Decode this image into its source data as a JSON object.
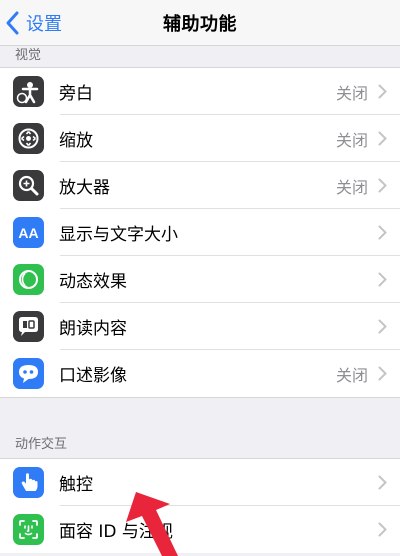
{
  "nav": {
    "back_label": "设置",
    "title": "辅助功能"
  },
  "sections": [
    {
      "header": "视觉",
      "items": [
        {
          "label": "旁白",
          "value": "关闭",
          "icon": "voiceover-icon",
          "color": "#3a3a3c"
        },
        {
          "label": "缩放",
          "value": "关闭",
          "icon": "zoom-icon",
          "color": "#3a3a3c"
        },
        {
          "label": "放大器",
          "value": "关闭",
          "icon": "magnifier-icon",
          "color": "#3a3a3c"
        },
        {
          "label": "显示与文字大小",
          "value": "",
          "icon": "display-text-size-icon",
          "color": "#2f7cf6"
        },
        {
          "label": "动态效果",
          "value": "",
          "icon": "motion-icon",
          "color": "#30c04f"
        },
        {
          "label": "朗读内容",
          "value": "",
          "icon": "spoken-content-icon",
          "color": "#3a3a3c"
        },
        {
          "label": "口述影像",
          "value": "关闭",
          "icon": "audio-descriptions-icon",
          "color": "#2f7cf6"
        }
      ]
    },
    {
      "header": "动作交互",
      "items": [
        {
          "label": "触控",
          "value": "",
          "icon": "touch-icon",
          "color": "#2f7cf6"
        },
        {
          "label": "面容 ID 与注视",
          "value": "",
          "icon": "face-id-icon",
          "color": "#30c04f"
        }
      ]
    }
  ],
  "colors": {
    "accent": "#2f7cf6",
    "annotation_arrow": "#e8253a"
  }
}
